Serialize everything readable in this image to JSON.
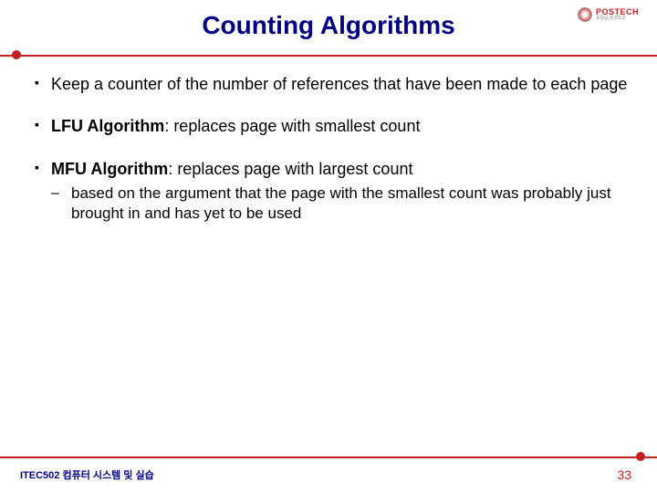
{
  "logo": {
    "main": "POSTECH",
    "sub": "포항공과대학교"
  },
  "title": "Counting Algorithms",
  "bullets": [
    {
      "html": "Keep a counter of the number of references that have been made to each page"
    },
    {
      "html": "<strong>LFU Algorithm</strong>:  replaces page with smallest count"
    },
    {
      "html": "<strong>MFU Algorithm</strong>: replaces page with largest count",
      "sub": "based on the argument that the page with the smallest count was probably just brought in and has yet to be used"
    }
  ],
  "footer": {
    "left": "ITEC502 컴퓨터 시스템 및 실습",
    "right": "33"
  }
}
